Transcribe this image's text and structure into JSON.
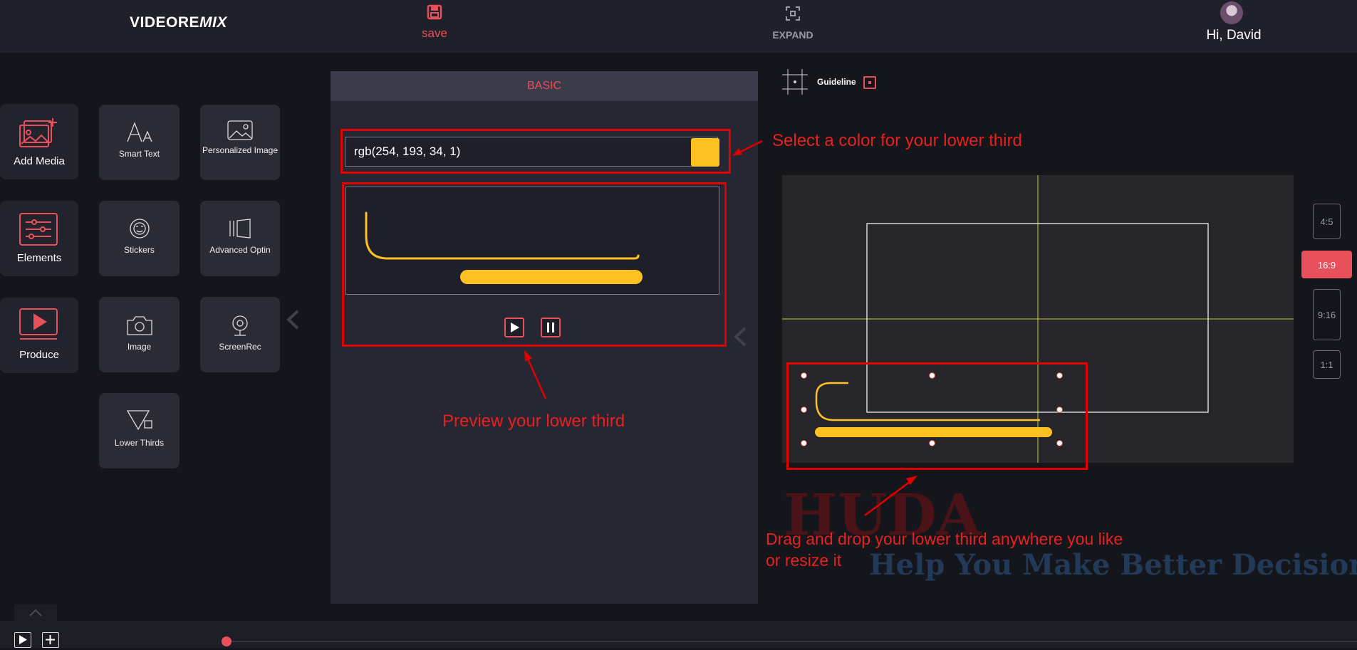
{
  "header": {
    "logo_text_main": "VIDEORE",
    "logo_text_italic": "MIX",
    "save_label": "save",
    "expand_label": "EXPAND",
    "greeting": "Hi, David"
  },
  "left_nav": {
    "main": [
      {
        "label": "Add Media",
        "icon": "add-media-icon"
      },
      {
        "label": "Elements",
        "icon": "elements-sliders-icon"
      },
      {
        "label": "Produce",
        "icon": "produce-play-icon"
      }
    ],
    "tools": [
      {
        "label": "Smart Text",
        "icon": "smart-text-icon"
      },
      {
        "label": "Personalized Image",
        "icon": "personalized-image-icon"
      },
      {
        "label": "Stickers",
        "icon": "stickers-icon"
      },
      {
        "label": "Advanced Optin",
        "icon": "advanced-optin-icon"
      },
      {
        "label": "Image",
        "icon": "camera-icon"
      },
      {
        "label": "ScreenRec",
        "icon": "webcam-icon"
      },
      {
        "label": "Lower Thirds",
        "icon": "lower-thirds-icon"
      }
    ]
  },
  "panel": {
    "tab_label": "BASIC",
    "color_value": "rgb(254, 193, 34, 1)",
    "swatch_color": "#fec122"
  },
  "annotations": {
    "color": "Select a color for your lower third",
    "preview": "Preview your lower third",
    "drag_line1": "Drag and drop your lower third anywhere you like",
    "drag_line2": "or resize it"
  },
  "canvas": {
    "guideline_label": "Guideline",
    "ratios": [
      "4:5",
      "16:9",
      "9:16",
      "1:1"
    ],
    "active_ratio": "16:9"
  },
  "watermark": {
    "line1": "HUDA",
    "line2": "Help You Make Better Decisions"
  },
  "colors": {
    "accent": "#e8505b",
    "lower_third": "#fec122",
    "annotation": "#e00000"
  }
}
